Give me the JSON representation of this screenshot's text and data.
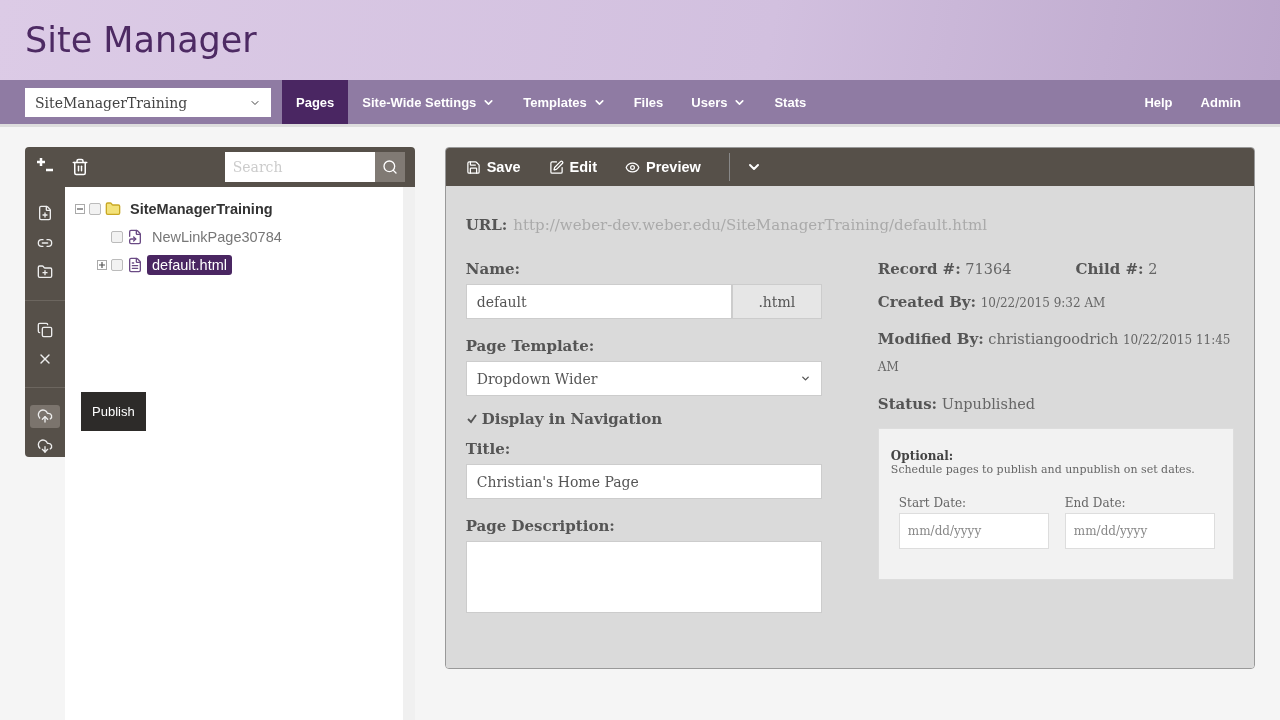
{
  "header": {
    "title": "Site Manager"
  },
  "nav": {
    "site_select": {
      "value": "SiteManagerTraining"
    },
    "items": [
      {
        "label": "Pages",
        "dropdown": false,
        "selected": true
      },
      {
        "label": "Site-Wide Settings",
        "dropdown": true,
        "selected": false
      },
      {
        "label": "Templates",
        "dropdown": true,
        "selected": false
      },
      {
        "label": "Files",
        "dropdown": false,
        "selected": false
      },
      {
        "label": "Users",
        "dropdown": true,
        "selected": false
      },
      {
        "label": "Stats",
        "dropdown": false,
        "selected": false
      }
    ],
    "right_items": [
      {
        "label": "Help"
      },
      {
        "label": "Admin"
      }
    ]
  },
  "tree_panel": {
    "search": {
      "placeholder": "Search"
    },
    "tools": [
      {
        "kind": "new-page",
        "hovered": false
      },
      {
        "kind": "new-link",
        "hovered": false
      },
      {
        "kind": "new-folder",
        "hovered": false
      },
      {
        "kind": "copy",
        "hovered": false
      },
      {
        "kind": "delete",
        "hovered": false
      },
      {
        "kind": "publish",
        "hovered": true
      },
      {
        "kind": "unpublish",
        "hovered": false
      }
    ],
    "tooltip": {
      "label": "Publish"
    },
    "tree": [
      {
        "label": "SiteManagerTraining",
        "kind": "folder",
        "checked": false,
        "selected": false,
        "expanded": true,
        "children": [
          {
            "label": "NewLinkPage30784",
            "kind": "link",
            "checked": false,
            "selected": false
          },
          {
            "label": "default.html",
            "kind": "page",
            "checked": false,
            "selected": true,
            "expanded": false
          }
        ]
      }
    ]
  },
  "editor": {
    "toolbar": [
      {
        "label": "Save",
        "kind": "save"
      },
      {
        "label": "Edit",
        "kind": "edit"
      },
      {
        "label": "Preview",
        "kind": "preview"
      }
    ],
    "url": {
      "label": "URL:",
      "value": "http://weber-dev.weber.edu/SiteManagerTraining/default.html"
    },
    "name": {
      "label": "Name:",
      "value": "default",
      "suffix": ".html"
    },
    "page_template": {
      "label": "Page Template:",
      "value": "Dropdown Wider"
    },
    "display_in_navigation": {
      "label": "Display in Navigation",
      "checked": true
    },
    "title": {
      "label": "Title:",
      "value": "Christian's Home Page"
    },
    "page_description": {
      "label": "Page Description:"
    },
    "record": {
      "label": "Record #:",
      "value": "71364"
    },
    "child": {
      "label": "Child #:",
      "value": "2"
    },
    "created_by": {
      "label": "Created By:",
      "date": "10/22/2015 9:32 AM"
    },
    "modified_by": {
      "label": "Modified By:",
      "value": "christiangoodrich",
      "date": "10/22/2015 11:45 AM"
    },
    "status": {
      "label": "Status:",
      "value": "Unpublished"
    },
    "schedule": {
      "title": "Optional:",
      "text": "Schedule pages to publish and unpublish on set dates.",
      "start_date": {
        "label": "Start Date:",
        "placeholder": "mm/dd/yyyy"
      },
      "end_date": {
        "label": "End Date:",
        "placeholder": "mm/dd/yyyy"
      }
    }
  }
}
